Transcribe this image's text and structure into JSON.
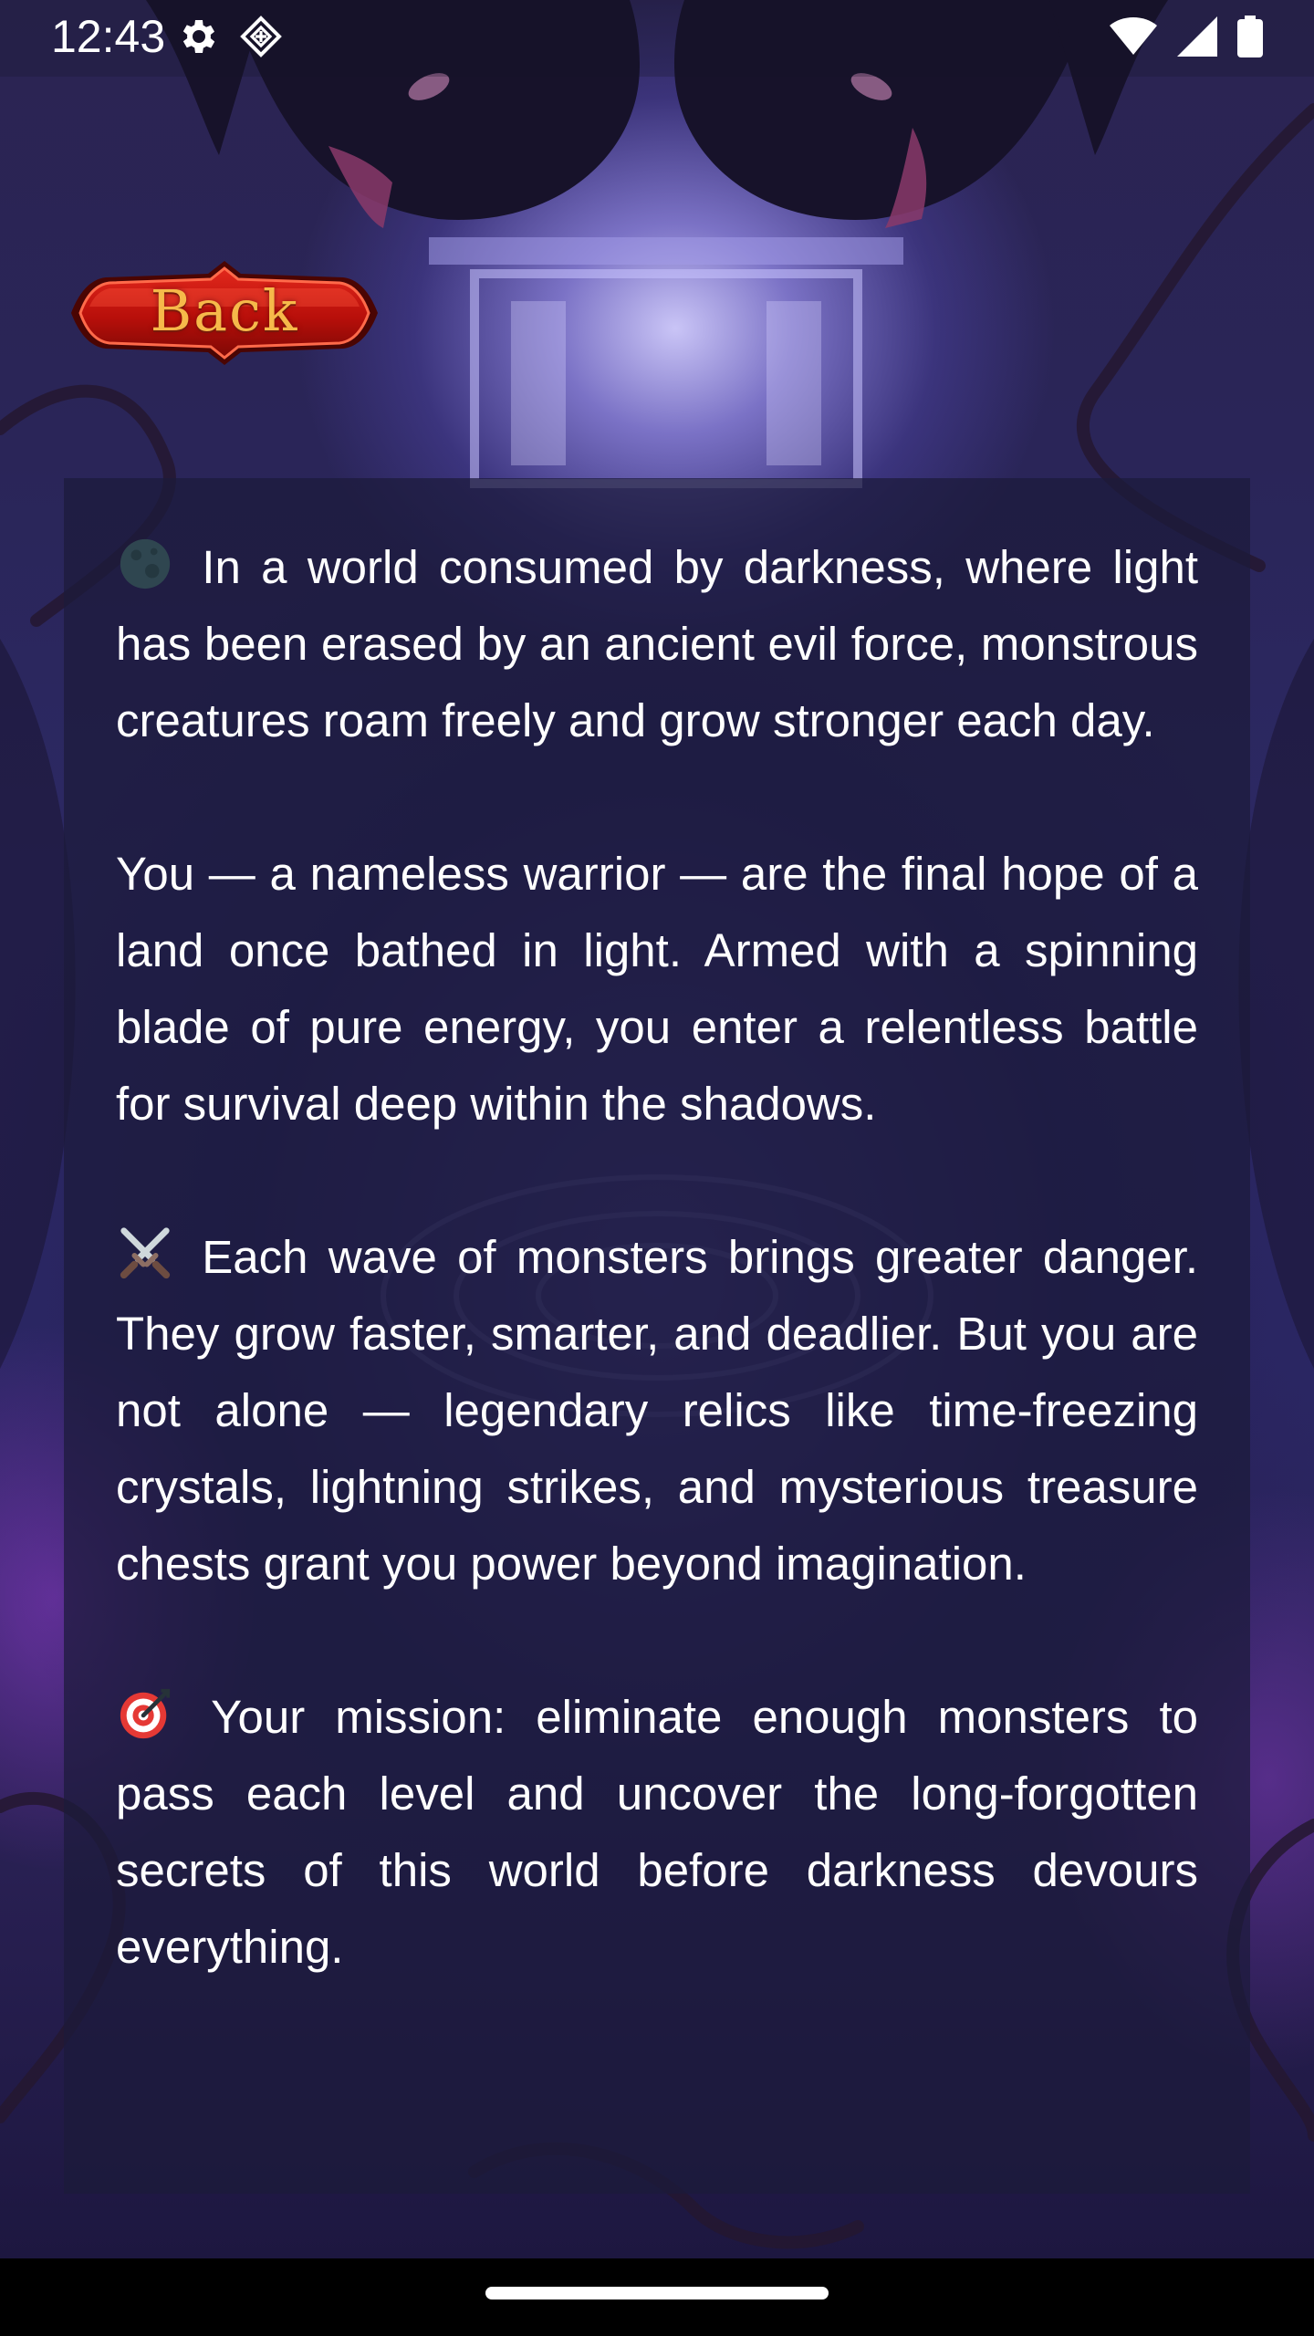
{
  "status_bar": {
    "time": "12:43",
    "left_icons": [
      "settings-icon",
      "diamond-app-icon"
    ],
    "right_icons": [
      "wifi-icon",
      "cellular-signal-icon",
      "battery-icon"
    ]
  },
  "back_button": {
    "label": "Back"
  },
  "story": {
    "paragraphs": [
      {
        "emoji": "dark-moon-icon",
        "text": " In a world consumed by darkness, where light has been erased by an ancient evil force, monstrous creatures roam freely and grow stronger each day."
      },
      {
        "emoji": "",
        "text": "You — a nameless warrior — are the final hope of a land once bathed in light. Armed with a spinning blade of pure energy, you enter a relentless battle for survival deep within the shadows."
      },
      {
        "emoji": "crossed-swords-icon",
        "text": " Each wave of monsters brings greater danger. They grow faster, smarter, and deadlier. But you are not alone — legendary relics like time-freezing crystals, lightning strikes, and mysterious treasure chests grant you power beyond imagination."
      },
      {
        "emoji": "target-icon",
        "text": " Your mission: eliminate enough monsters to pass each level and uncover the long-forgotten secrets of this world before darkness devours everything."
      }
    ]
  },
  "colors": {
    "panel_bg": "#1c1a3a",
    "back_button_red": "#c8140c",
    "back_button_text": "#f6b94a",
    "text": "#ffffff"
  }
}
